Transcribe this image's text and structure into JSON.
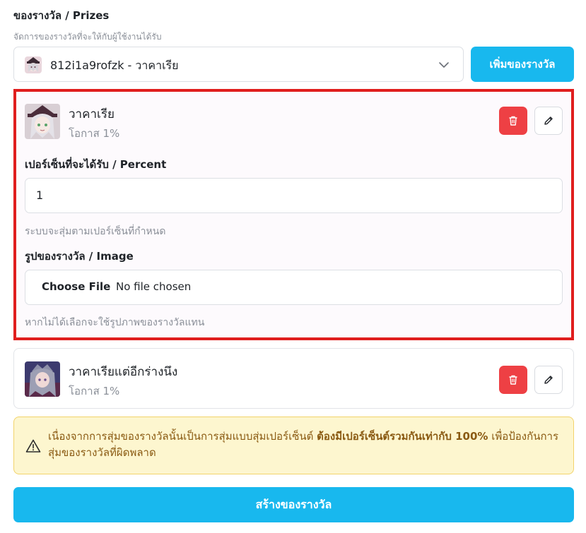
{
  "header": {
    "title": "ของรางวัล / Prizes",
    "subtitle": "จัดการของรางวัลที่จะให้กับผู้ใช้งานได้รับ"
  },
  "prize_select": {
    "selected_value": "812i1a9rofzk",
    "selected_name": "วาคาเรีย",
    "separator": " - "
  },
  "add_button": {
    "label": "เพิ่มของรางวัล"
  },
  "prizes": [
    {
      "name": "วาคาเรีย",
      "chance": "โอกาส 1%",
      "expanded": true,
      "percent_label": "เปอร์เซ็นที่จะได้รับ / Percent",
      "percent_value": "1",
      "percent_hint": "ระบบจะสุ่มตามเปอร์เซ็นที่กำหนด",
      "image_label": "รูปของรางวัล / Image",
      "file_button": "Choose File",
      "file_status": "No file chosen",
      "image_hint": "หากไม่ได้เลือกจะใช้รูปภาพของรางวัลแทน"
    },
    {
      "name": "วาคาเรียแต่อีกร่างนึง",
      "chance": "โอกาส 1%",
      "expanded": false
    }
  ],
  "alert": {
    "text_before": "เนื่องจากการสุ่มของรางวัลนั้นเป็นการสุ่มแบบสุ่มเปอร์เซ็นต์ ",
    "text_bold": "ต้องมีเปอร์เซ็นต์รวมกันเท่ากับ 100%",
    "text_after": " เพื่อป้องกันการสุ่มของรางวัลที่ผิดพลาด"
  },
  "create_button": {
    "label": "สร้างของรางวัล"
  },
  "colors": {
    "accent": "#18b8ee",
    "danger": "#ee4044",
    "highlight_border": "#e01e1e",
    "alert_bg": "#fdf6cf",
    "alert_text": "#8a5a12"
  },
  "icons": {
    "chevron": "chevron-down-icon",
    "delete": "trash-icon",
    "edit": "pencil-icon",
    "alert": "warning-triangle-icon"
  }
}
